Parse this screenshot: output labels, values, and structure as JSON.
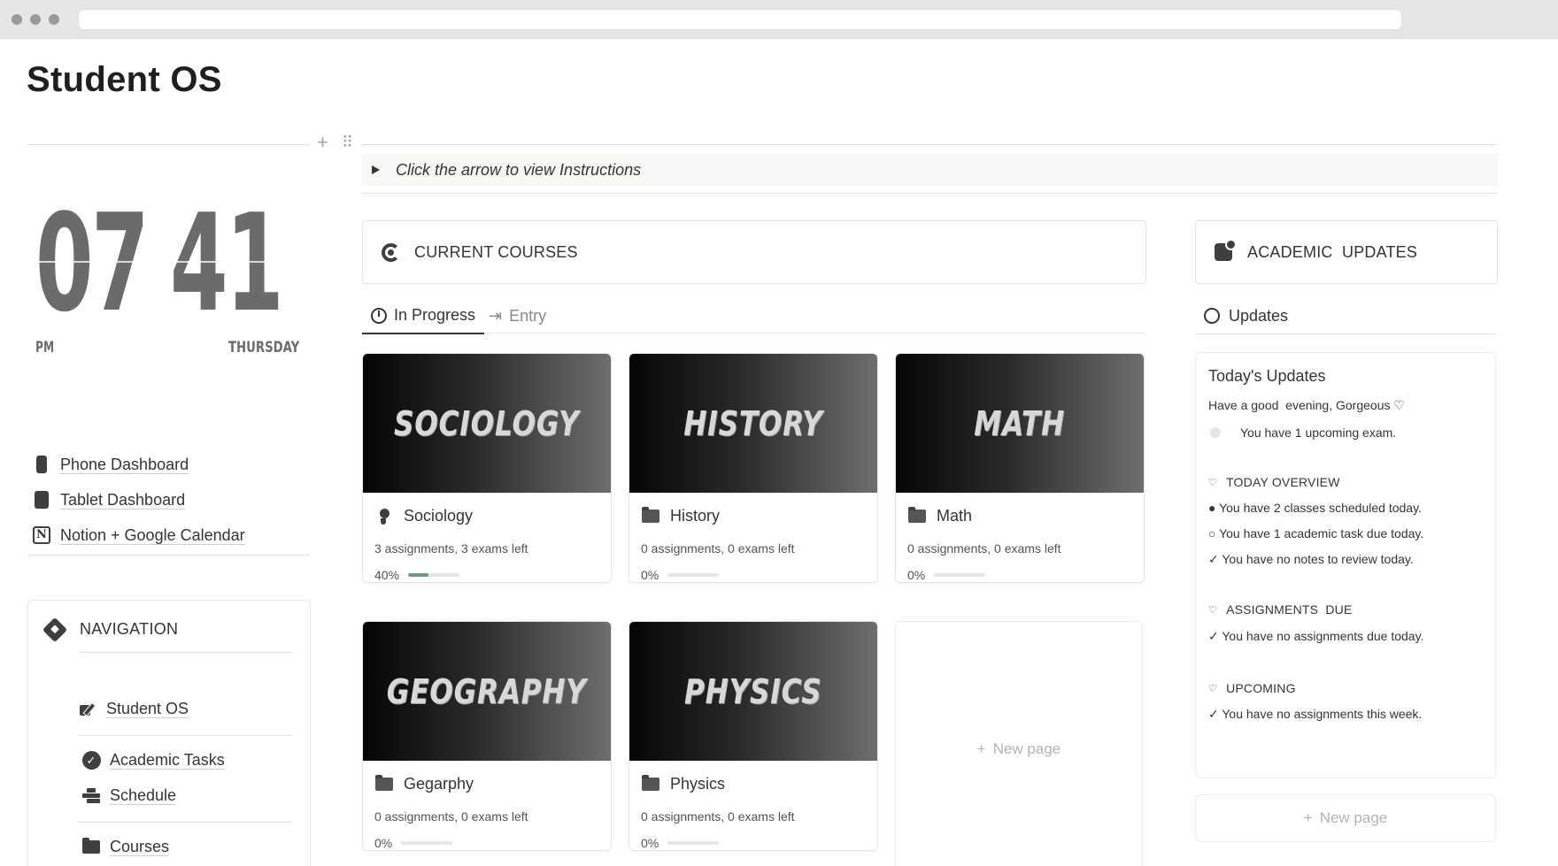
{
  "page": {
    "title": "Student OS"
  },
  "clock": {
    "hours": "07",
    "minutes": "41",
    "ampm": "PM",
    "day": "THURSDAY"
  },
  "dashboards": [
    {
      "label": "Phone Dashboard",
      "icon": "phone-icon"
    },
    {
      "label": "Tablet Dashboard",
      "icon": "tablet-icon"
    },
    {
      "label": "Notion + Google Calendar",
      "icon": "notion-icon"
    }
  ],
  "navigation": {
    "heading": "NAVIGATION",
    "items": [
      {
        "label": "Student OS",
        "icon": "pen-square-icon"
      },
      {
        "label": "Academic Tasks",
        "icon": "check-circle-icon"
      },
      {
        "label": "Schedule",
        "icon": "schedule-icon"
      },
      {
        "label": "Courses",
        "icon": "folder-icon"
      }
    ]
  },
  "toggle": {
    "text": "Click the arrow to view Instructions"
  },
  "courses": {
    "heading": "CURRENT COURSES",
    "tabs": {
      "active": "In Progress",
      "other": "Entry"
    },
    "cards": [
      {
        "cover": "SOCIOLOGY",
        "title": "Sociology",
        "icon": "person-icon",
        "meta": "3 assignments, 3 exams left",
        "progress_label": "40%",
        "progress": 0.4
      },
      {
        "cover": "HISTORY",
        "title": "History",
        "icon": "folder-icon",
        "meta": "0 assignments, 0 exams left",
        "progress_label": "0%",
        "progress": 0
      },
      {
        "cover": "MATH",
        "title": "Math",
        "icon": "folder-icon",
        "meta": "0 assignments, 0 exams left",
        "progress_label": "0%",
        "progress": 0
      },
      {
        "cover": "GEOGRAPHY",
        "title": "Gegarphy",
        "icon": "folder-icon",
        "meta": "0 assignments, 0 exams left",
        "progress_label": "0%",
        "progress": 0
      },
      {
        "cover": "PHYSICS",
        "title": "Physics",
        "icon": "folder-icon",
        "meta": "0 assignments, 0 exams left",
        "progress_label": "0%",
        "progress": 0
      }
    ],
    "new_page": "New page"
  },
  "updates": {
    "heading": "ACADEMIC  UPDATES",
    "tab": "Updates",
    "card": {
      "title": "Today's Updates",
      "greeting": "Have a good  evening, Gorgeous ♡",
      "exam": "You have 1 upcoming exam.",
      "overview_heading": "TODAY OVERVIEW",
      "overview": [
        "● You have 2 classes scheduled today.",
        "○ You have 1 academic task due today.",
        "✓ You have no notes to review today."
      ],
      "assignments_heading": "ASSIGNMENTS  DUE",
      "assignments": "✓ You have no assignments due today.",
      "upcoming_heading": "UPCOMING",
      "upcoming": "✓ You have no assignments this week."
    },
    "new_page": "New page"
  },
  "colors": {
    "progress_fill": "#6f9a7e",
    "text": "#37352f"
  }
}
